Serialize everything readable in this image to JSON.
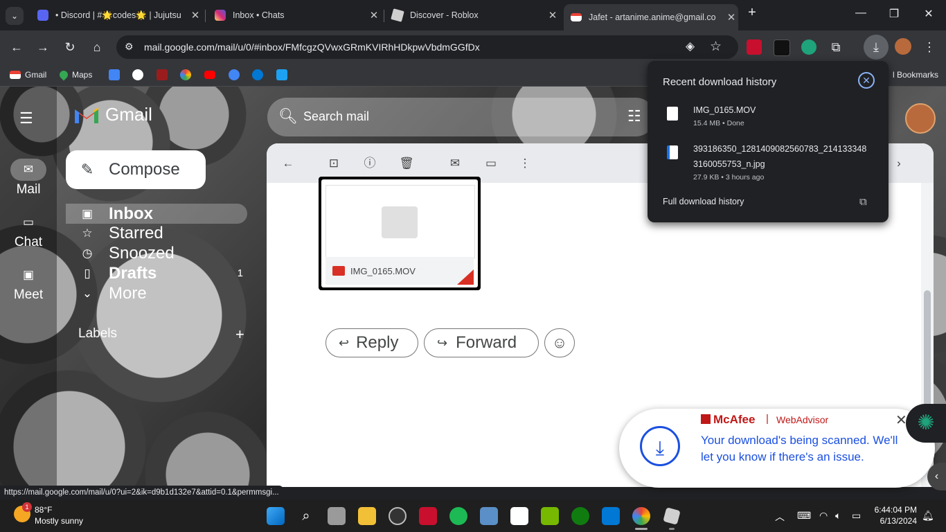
{
  "browser": {
    "tabs": [
      {
        "title": "• Discord | #🌟codes🌟 | Jujutsu",
        "icon": "discord-icon"
      },
      {
        "title": "Inbox • Chats",
        "icon": "instagram-icon"
      },
      {
        "title": "Discover - Roblox",
        "icon": "roblox-icon"
      },
      {
        "title": "Jafet - artanime.anime@gmail.co",
        "icon": "gmail-icon",
        "active": true
      }
    ],
    "url": "mail.google.com/mail/u/0/#inbox/FMfcgzQVwxGRmKVIRhHDkpwVbdmGGfDx",
    "bookmarks": [
      "Gmail",
      "Maps"
    ],
    "bookmarks_right": "l Bookmarks"
  },
  "gmail": {
    "logo_text": "Gmail",
    "rail": [
      "Mail",
      "Chat",
      "Meet"
    ],
    "compose": "Compose",
    "search_placeholder": "Search mail",
    "nav": [
      {
        "label": "Inbox",
        "count": ""
      },
      {
        "label": "Starred",
        "count": ""
      },
      {
        "label": "Snoozed",
        "count": ""
      },
      {
        "label": "Drafts",
        "count": "1"
      },
      {
        "label": "More",
        "count": ""
      }
    ],
    "labels_heading": "Labels",
    "attachment_name": "IMG_0165.MOV",
    "reply": "Reply",
    "forward": "Forward"
  },
  "downloads": {
    "title": "Recent download history",
    "items": [
      {
        "name": "IMG_0165.MOV",
        "meta": "15.4 MB • Done"
      },
      {
        "name_line1": "393186350_1281409082560783_214133348",
        "name_line2": "3160055753_n.jpg",
        "meta": "27.9 KB • 3 hours ago"
      }
    ],
    "full_history": "Full download history"
  },
  "mcafee": {
    "brand": "McAfee",
    "product": "WebAdvisor",
    "message": "Your download's being scanned. We'll let you know if there's an issue."
  },
  "status_url": "https://mail.google.com/mail/u/0?ui=2&ik=d9b1d132e7&attid=0.1&permmsgi...",
  "taskbar": {
    "weather_temp": "88°F",
    "weather_cond": "Mostly sunny",
    "weather_badge": "1",
    "time": "6:44:04 PM",
    "date": "6/13/2024"
  },
  "colors": {
    "gmail_red": "#ea4335",
    "mcafee_red": "#c01818",
    "mcafee_blue": "#1a4fe0",
    "chrome_dark": "#202124"
  }
}
